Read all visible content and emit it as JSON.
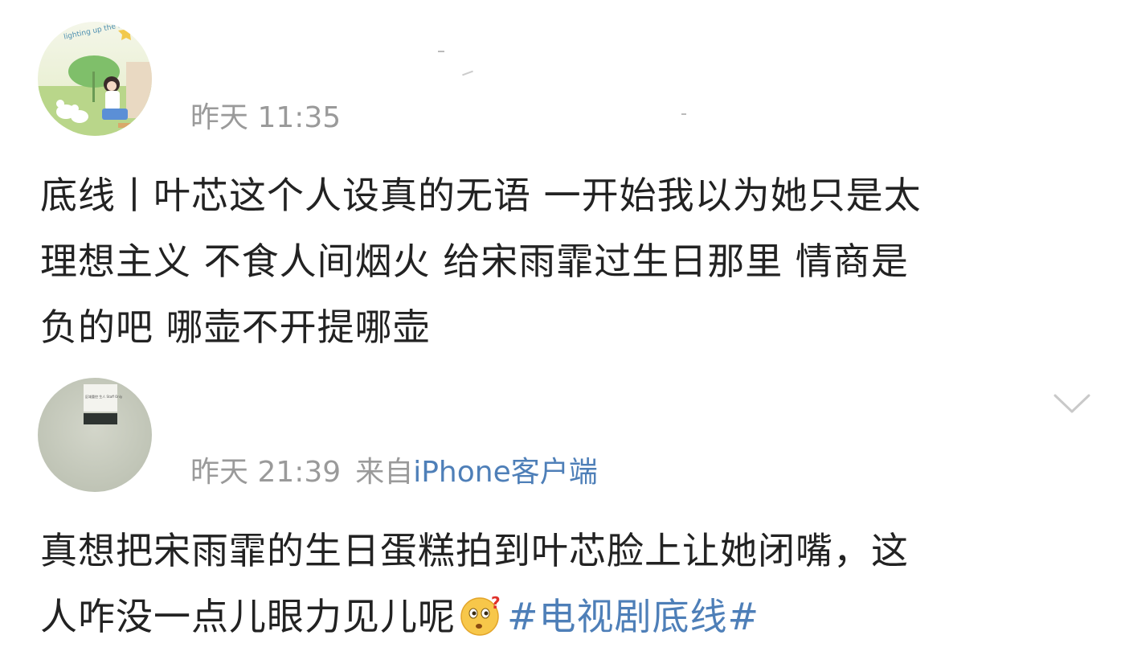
{
  "avatar_watermark_text": "lighting up the stars",
  "avatar2_sign_text": "区域重控 生人 Staff Only",
  "posts": [
    {
      "meta": {
        "time": "昨天 11:35"
      },
      "body": {
        "line1": "底线丨叶芯这个人设真的无语 一开始我以为她只是太",
        "line2": "理想主义 不食人间烟火 给宋雨霏过生日那里 情商是",
        "line3": "负的吧 哪壶不开提哪壶"
      }
    },
    {
      "meta": {
        "time": "昨天 21:39",
        "from": "来自",
        "client": "iPhone客户端"
      },
      "body": {
        "line1": "真想把宋雨霏的生日蛋糕拍到叶芯脸上让她闭嘴，这",
        "line2": "人咋没一点儿眼力见儿呢",
        "hashtag": "#电视剧底线#"
      },
      "emoji": "thinking-face-emoji"
    }
  ],
  "icons": [
    "chevron-down-icon",
    "thinking-face-emoji"
  ],
  "colors": {
    "text": "#222222",
    "meta": "#9a9a9a",
    "link": "#4e7fb8",
    "background": "#ffffff"
  }
}
